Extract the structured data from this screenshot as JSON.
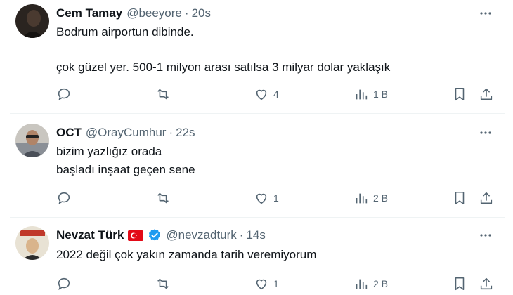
{
  "tweets": [
    {
      "name": "Cem Tamay",
      "handle": "@beeyore",
      "sep": "·",
      "time": "20s",
      "lines": [
        "Bodrum airportun dibinde.",
        "",
        "çok güzel yer. 500-1 milyon arası satılsa 3 milyar dolar yaklaşık"
      ],
      "likes": "4",
      "views": "1 B"
    },
    {
      "name": "OCT",
      "handle": "@OrayCumhur",
      "sep": "·",
      "time": "22s",
      "lines": [
        "bizim yazlığız orada",
        "başladı inşaat geçen sene"
      ],
      "likes": "1",
      "views": "2 B"
    },
    {
      "name": "Nevzat Türk",
      "handle": "@nevzadturk",
      "sep": "·",
      "time": "14s",
      "lines": [
        "2022 değil çok yakın zamanda tarih veremiyorum"
      ],
      "likes": "1",
      "views": "2 B"
    }
  ],
  "colors": {
    "text": "#0f1419",
    "muted": "#536471",
    "divider": "#eff3f4",
    "verified": "#1d9bf0",
    "flag": "#e30a17"
  },
  "icons": [
    "more-icon",
    "reply-icon",
    "retweet-icon",
    "like-icon",
    "views-icon",
    "bookmark-icon",
    "share-icon",
    "verified-icon",
    "turkey-flag-icon"
  ]
}
